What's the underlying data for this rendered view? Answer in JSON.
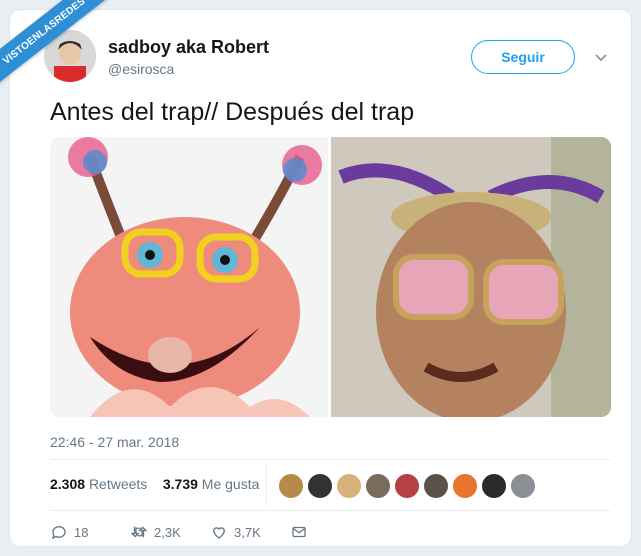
{
  "watermark": {
    "text": "VISTOENLASREDES"
  },
  "user": {
    "name": "sadboy aka Robert",
    "handle": "@esirosca",
    "avatar_icon": "avatar-icon"
  },
  "follow_button": {
    "label": "Seguir"
  },
  "menu": {
    "icon": "chevron-down-icon"
  },
  "tweet": {
    "text": "Antes del trap// Después del trap",
    "timestamp": "22:46 - 27 mar. 2018"
  },
  "media": {
    "left": {
      "icon": "pink-puppet-image"
    },
    "right": {
      "icon": "man-dreadlocks-sunglasses-image"
    }
  },
  "stats": {
    "retweets_count": "2.308",
    "retweets_label": "Retweets",
    "likes_count": "3.739",
    "likes_label": "Me gusta"
  },
  "actions": {
    "replies": "18",
    "retweets": "2,3K",
    "likes": "3,7K"
  },
  "colors": {
    "accent": "#1da1f2",
    "ribbon": "#2f8fd6"
  }
}
